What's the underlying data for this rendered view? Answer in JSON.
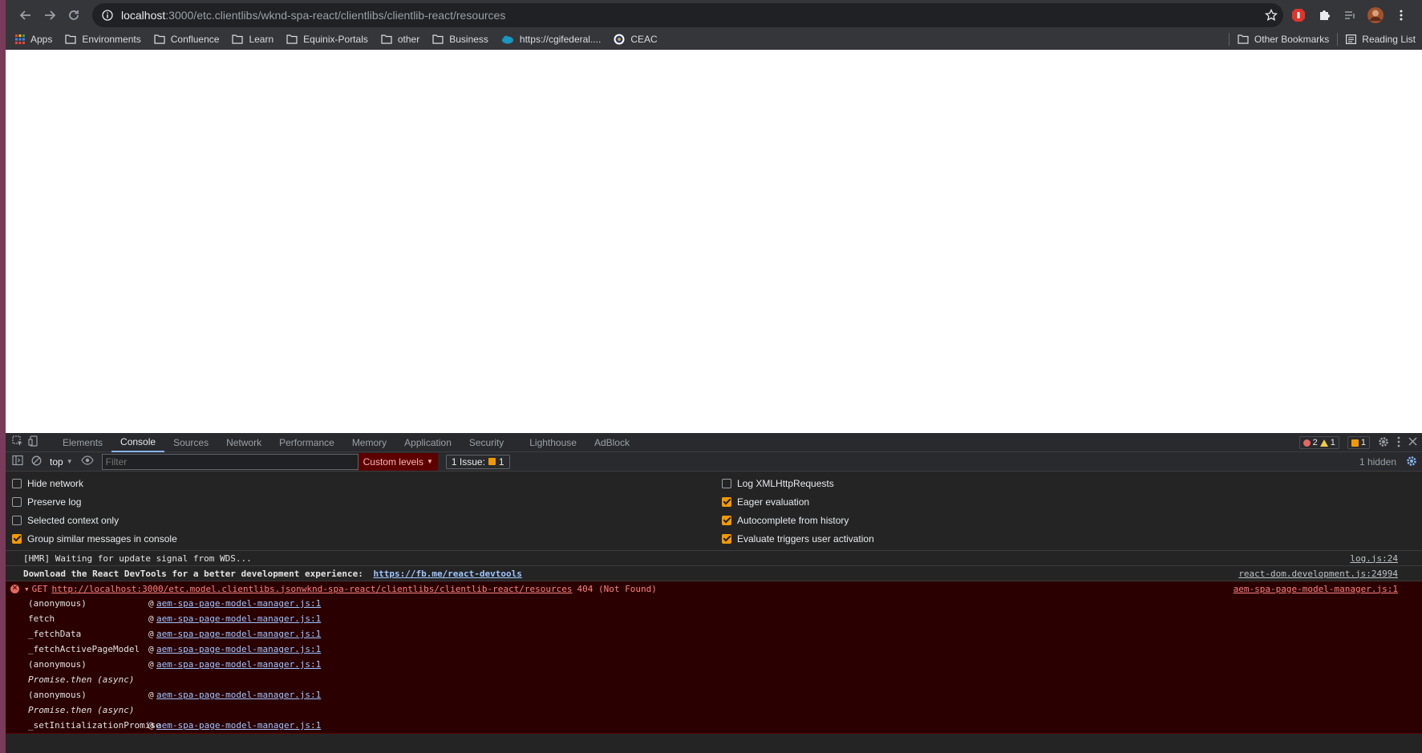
{
  "browser": {
    "url_host": "localhost",
    "url_path": ":3000/etc.clientlibs/wknd-spa-react/clientlibs/clientlib-react/resources"
  },
  "bookmarks": {
    "items": [
      "Apps",
      "Environments",
      "Confluence",
      "Learn",
      "Equinix-Portals",
      "other",
      "Business",
      "https://cgifederal....",
      "CEAC"
    ],
    "other_bookmarks": "Other Bookmarks",
    "reading_list": "Reading List"
  },
  "devtools": {
    "tabs": [
      "Elements",
      "Console",
      "Sources",
      "Network",
      "Performance",
      "Memory",
      "Application",
      "Security",
      "Lighthouse",
      "AdBlock"
    ],
    "active_tab": "Console",
    "errors_count": "2",
    "warnings_count": "1",
    "issues_badge_count": "1",
    "context": "top",
    "filter_placeholder": "Filter",
    "levels_label": "Custom levels",
    "issues_label": "1 Issue:",
    "issues_count": "1",
    "hidden_label": "1 hidden",
    "settings_left": [
      {
        "label": "Hide network",
        "checked": false
      },
      {
        "label": "Preserve log",
        "checked": false
      },
      {
        "label": "Selected context only",
        "checked": false
      },
      {
        "label": "Group similar messages in console",
        "checked": true
      }
    ],
    "settings_right": [
      {
        "label": "Log XMLHttpRequests",
        "checked": false
      },
      {
        "label": "Eager evaluation",
        "checked": true
      },
      {
        "label": "Autocomplete from history",
        "checked": true
      },
      {
        "label": "Evaluate triggers user activation",
        "checked": true
      }
    ]
  },
  "console": {
    "msg1": {
      "text": "[HMR] Waiting for update signal from WDS...",
      "source": "log.js:24"
    },
    "msg2": {
      "text": "Download the React DevTools for a better development experience: ",
      "link": "https://fb.me/react-devtools",
      "source": "react-dom.development.js:24994"
    },
    "error": {
      "method": "GET",
      "url": "http://localhost:3000/etc.model.clientlibs.jsonwknd-spa-react/clientlibs/clientlib-react/resources",
      "status": "404 (Not Found)",
      "source": "aem-spa-page-model-manager.js:1",
      "frames": [
        {
          "fn": "(anonymous)",
          "at": "@",
          "link": "aem-spa-page-model-manager.js:1"
        },
        {
          "fn": "fetch",
          "at": "@",
          "link": "aem-spa-page-model-manager.js:1"
        },
        {
          "fn": "_fetchData",
          "at": "@",
          "link": "aem-spa-page-model-manager.js:1"
        },
        {
          "fn": "_fetchActivePageModel",
          "at": "@",
          "link": "aem-spa-page-model-manager.js:1"
        },
        {
          "fn": "(anonymous)",
          "at": "@",
          "link": "aem-spa-page-model-manager.js:1"
        },
        {
          "fn": "Promise.then (async)",
          "at": "",
          "link": ""
        },
        {
          "fn": "(anonymous)",
          "at": "@",
          "link": "aem-spa-page-model-manager.js:1"
        },
        {
          "fn": "Promise.then (async)",
          "at": "",
          "link": ""
        },
        {
          "fn": "_setInitializationPromise",
          "at": "@",
          "link": "aem-spa-page-model-manager.js:1"
        }
      ]
    }
  }
}
